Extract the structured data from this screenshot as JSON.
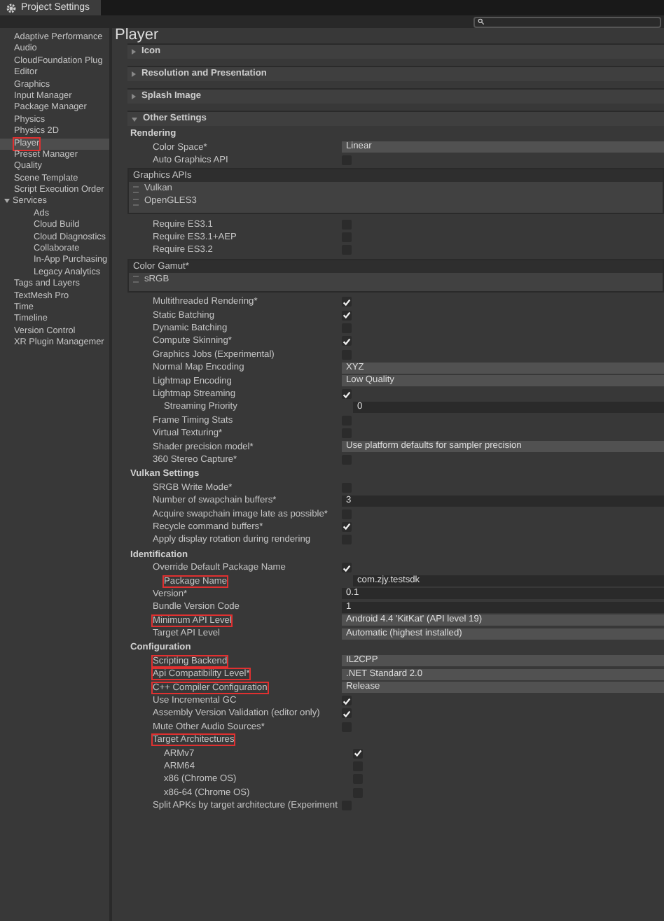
{
  "window": {
    "title": "Project Settings"
  },
  "sidebar": {
    "items": [
      {
        "label": "Adaptive Performance",
        "selected": false,
        "highlighted": false
      },
      {
        "label": "Audio",
        "selected": false,
        "highlighted": false
      },
      {
        "label": "CloudFoundation Plug",
        "selected": false,
        "highlighted": false
      },
      {
        "label": "Editor",
        "selected": false,
        "highlighted": false
      },
      {
        "label": "Graphics",
        "selected": false,
        "highlighted": false
      },
      {
        "label": "Input Manager",
        "selected": false,
        "highlighted": false
      },
      {
        "label": "Package Manager",
        "selected": false,
        "highlighted": false
      },
      {
        "label": "Physics",
        "selected": false,
        "highlighted": false
      },
      {
        "label": "Physics 2D",
        "selected": false,
        "highlighted": false
      },
      {
        "label": "Player",
        "selected": true,
        "highlighted": true
      },
      {
        "label": "Preset Manager",
        "selected": false,
        "highlighted": false
      },
      {
        "label": "Quality",
        "selected": false,
        "highlighted": false
      },
      {
        "label": "Scene Template",
        "selected": false,
        "highlighted": false
      },
      {
        "label": "Script Execution Order",
        "selected": false,
        "highlighted": false
      },
      {
        "label": "Services",
        "selected": false,
        "highlighted": false,
        "expanded": true,
        "children": [
          {
            "label": "Ads",
            "selected": false,
            "highlighted": false
          },
          {
            "label": "Cloud Build",
            "selected": false,
            "highlighted": false
          },
          {
            "label": "Cloud Diagnostics",
            "selected": false,
            "highlighted": false
          },
          {
            "label": "Collaborate",
            "selected": false,
            "highlighted": false
          },
          {
            "label": "In-App Purchasing",
            "selected": false,
            "highlighted": false
          },
          {
            "label": "Legacy Analytics",
            "selected": false,
            "highlighted": false
          }
        ]
      },
      {
        "label": "Tags and Layers",
        "selected": false,
        "highlighted": false
      },
      {
        "label": "TextMesh Pro",
        "selected": false,
        "highlighted": false
      },
      {
        "label": "Time",
        "selected": false,
        "highlighted": false
      },
      {
        "label": "Timeline",
        "selected": false,
        "highlighted": false
      },
      {
        "label": "Version Control",
        "selected": false,
        "highlighted": false
      },
      {
        "label": "XR Plugin Managemer",
        "selected": false,
        "highlighted": false
      }
    ]
  },
  "page": {
    "title": "Player"
  },
  "sections": [
    {
      "label": "Icon",
      "expanded": false
    },
    {
      "label": "Resolution and Presentation",
      "expanded": false
    },
    {
      "label": "Splash Image",
      "expanded": false
    },
    {
      "label": "Other Settings",
      "expanded": true,
      "rows": [
        {
          "kind": "group",
          "label": "Rendering"
        },
        {
          "kind": "dropdown",
          "label": "Color Space*",
          "value": "Linear"
        },
        {
          "kind": "checkbox",
          "label": "Auto Graphics API",
          "checked": false
        },
        {
          "kind": "list",
          "label": "Graphics APIs",
          "items": [
            "Vulkan",
            "OpenGLES3"
          ]
        },
        {
          "kind": "checkbox",
          "label": "Require ES3.1",
          "checked": false
        },
        {
          "kind": "checkbox",
          "label": "Require ES3.1+AEP",
          "checked": false
        },
        {
          "kind": "checkbox",
          "label": "Require ES3.2",
          "checked": false
        },
        {
          "kind": "list",
          "label": "Color Gamut*",
          "items": [
            "sRGB"
          ]
        },
        {
          "kind": "checkbox",
          "label": "Multithreaded Rendering*",
          "checked": true
        },
        {
          "kind": "checkbox",
          "label": "Static Batching",
          "checked": true
        },
        {
          "kind": "checkbox",
          "label": "Dynamic Batching",
          "checked": false
        },
        {
          "kind": "checkbox",
          "label": "Compute Skinning*",
          "checked": true
        },
        {
          "kind": "checkbox",
          "label": "Graphics Jobs (Experimental)",
          "checked": false
        },
        {
          "kind": "dropdown",
          "label": "Normal Map Encoding",
          "value": "XYZ"
        },
        {
          "kind": "dropdown",
          "label": "Lightmap Encoding",
          "value": "Low Quality"
        },
        {
          "kind": "checkbox",
          "label": "Lightmap Streaming",
          "checked": true,
          "children": [
            {
              "kind": "field",
              "label": "Streaming Priority",
              "value": "0"
            }
          ]
        },
        {
          "kind": "checkbox",
          "label": "Frame Timing Stats",
          "checked": false
        },
        {
          "kind": "checkbox",
          "label": "Virtual Texturing*",
          "checked": false
        },
        {
          "kind": "dropdown",
          "label": "Shader precision model*",
          "value": "Use platform defaults for sampler precision"
        },
        {
          "kind": "checkbox",
          "label": "360 Stereo Capture*",
          "checked": false
        },
        {
          "kind": "group",
          "label": "Vulkan Settings"
        },
        {
          "kind": "checkbox",
          "label": "SRGB Write Mode*",
          "checked": false
        },
        {
          "kind": "field",
          "label": "Number of swapchain buffers*",
          "value": "3"
        },
        {
          "kind": "checkbox",
          "label": "Acquire swapchain image late as possible*",
          "checked": false
        },
        {
          "kind": "checkbox",
          "label": "Recycle command buffers*",
          "checked": true
        },
        {
          "kind": "checkbox",
          "label": "Apply display rotation during rendering",
          "checked": false
        },
        {
          "kind": "group",
          "label": "Identification"
        },
        {
          "kind": "checkbox",
          "label": "Override Default Package Name",
          "checked": true,
          "children": [
            {
              "kind": "field",
              "label": "Package Name",
              "value": "com.zjy.testsdk",
              "highlighted": true
            }
          ]
        },
        {
          "kind": "field",
          "label": "Version*",
          "value": "0.1"
        },
        {
          "kind": "field",
          "label": "Bundle Version Code",
          "value": "1"
        },
        {
          "kind": "dropdown",
          "label": "Minimum API Level",
          "value": "Android 4.4 'KitKat' (API level 19)",
          "highlighted": true
        },
        {
          "kind": "dropdown",
          "label": "Target API Level",
          "value": "Automatic (highest installed)"
        },
        {
          "kind": "group",
          "label": "Configuration"
        },
        {
          "kind": "dropdown",
          "label": "Scripting Backend",
          "value": "IL2CPP",
          "highlighted": true
        },
        {
          "kind": "dropdown",
          "label": "Api Compatibility Level*",
          "value": ".NET Standard 2.0",
          "highlighted": true
        },
        {
          "kind": "dropdown",
          "label": "C++ Compiler Configuration",
          "value": "Release",
          "highlighted": true
        },
        {
          "kind": "checkbox",
          "label": "Use Incremental GC",
          "checked": true
        },
        {
          "kind": "checkbox",
          "label": "Assembly Version Validation (editor only)",
          "checked": true
        },
        {
          "kind": "checkbox",
          "label": "Mute Other Audio Sources*",
          "checked": false
        },
        {
          "kind": "label",
          "label": "Target Architectures",
          "highlighted": true,
          "children": [
            {
              "kind": "checkbox",
              "label": "ARMv7",
              "checked": true
            },
            {
              "kind": "checkbox",
              "label": "ARM64",
              "checked": false
            },
            {
              "kind": "checkbox",
              "label": "x86 (Chrome OS)",
              "checked": false
            },
            {
              "kind": "checkbox",
              "label": "x86-64 (Chrome OS)",
              "checked": false
            }
          ]
        },
        {
          "kind": "checkbox",
          "label": "Split APKs by target architecture (Experiment",
          "checked": false
        }
      ]
    }
  ]
}
